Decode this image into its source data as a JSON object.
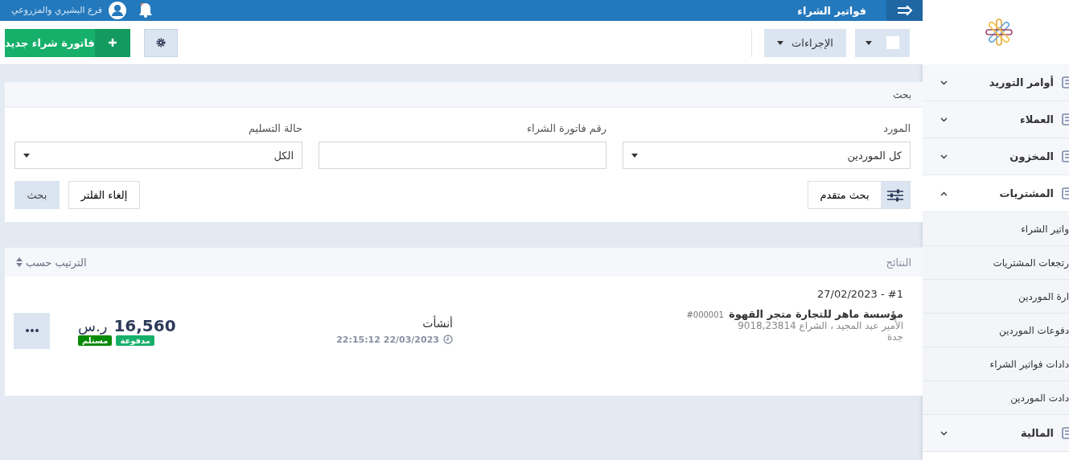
{
  "header": {
    "title": "فواتير الشراء",
    "branch": "فرع البشيري والمزروعي"
  },
  "toolbar": {
    "select_all_checked": false,
    "actions_label": "الإجراءات",
    "new_button": "فاتورة شراء جديد"
  },
  "search": {
    "title": "بحث",
    "fields": [
      {
        "label": "المورد",
        "kind": "select",
        "value": "كل الموردين"
      },
      {
        "label": "رقم فاتورة الشراء",
        "kind": "text"
      },
      {
        "label": "حالة التسليم",
        "kind": "select",
        "value": "الكل"
      }
    ],
    "advanced": "بحث متقدم",
    "clear": "إلغاء الفلتر",
    "submit": "بحث"
  },
  "results": {
    "title": "النتائج",
    "sort": "الترتيب حسب",
    "rows": [
      {
        "number": "27/02/2023 - #1",
        "supplier": "مؤسسة ماهر للتجارة متجر القهوة",
        "code": "#000001",
        "address": "الأمير عبد المجيد ، الشراع 9018,23814",
        "city": "جدة",
        "status": "أنشأت",
        "created": "22:15:12 22/03/2023",
        "amount": "16,560",
        "currency": "ر.س",
        "badges": [
          {
            "label": "مدفوعة",
            "color": "#17b06b"
          },
          {
            "label": "مستلم",
            "color": "#078a07"
          }
        ]
      }
    ]
  },
  "sidebar": {
    "items": [
      {
        "label": "أوامر التوريد",
        "expanded": false
      },
      {
        "label": "العملاء",
        "expanded": false
      },
      {
        "label": "المخزون",
        "expanded": false
      },
      {
        "label": "المشتريات",
        "expanded": true,
        "children": [
          {
            "label": "واتير الشراء"
          },
          {
            "label": "رتجعات المشتريات"
          },
          {
            "label": "ارة الموردين"
          },
          {
            "label": "دفوعات الموردين"
          },
          {
            "label": "دادات فواتير الشراء"
          },
          {
            "label": "دادت الموردين"
          }
        ]
      },
      {
        "label": "المالية",
        "expanded": false
      }
    ]
  }
}
